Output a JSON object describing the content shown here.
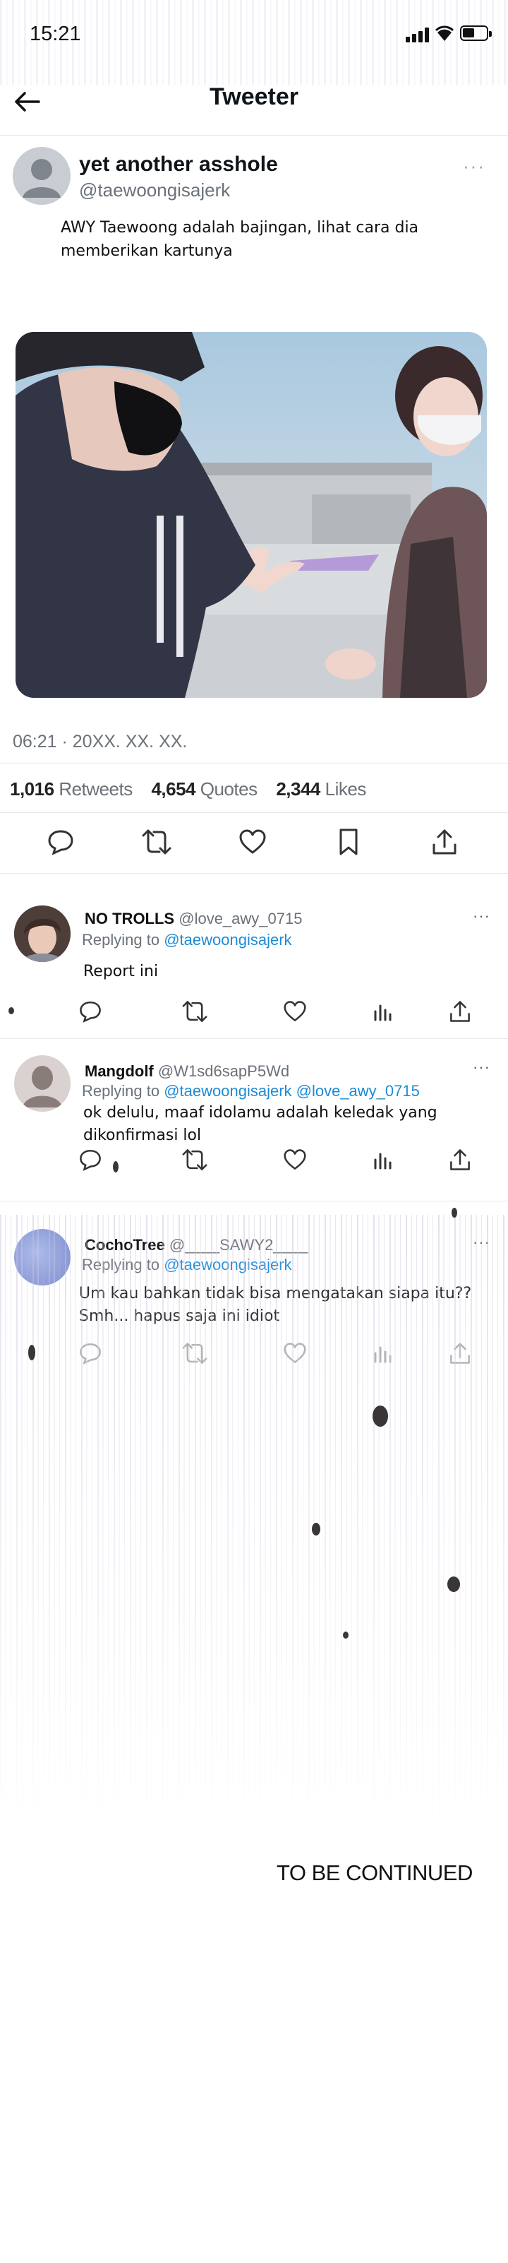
{
  "status_bar": {
    "time": "15:21"
  },
  "header": {
    "title": "Tweeter"
  },
  "tweet": {
    "display_name": "yet another asshole",
    "handle": "@taewoongisajerk",
    "more": "···",
    "text": "AWY Taewoong adalah bajingan, lihat cara dia memberikan kartunya",
    "meta": "06:21 · 20XX. XX. XX.",
    "stats": {
      "retweets_count": "1,016",
      "retweets_label": "Retweets",
      "quotes_count": "4,654",
      "quotes_label": "Quotes",
      "likes_count": "2,344",
      "likes_label": "Likes"
    }
  },
  "replies": [
    {
      "name": "NO TROLLS",
      "handle": "@love_awy_0715",
      "replying_prefix": "Replying to",
      "replying_to": "@taewoongisajerk",
      "text": "Report ini",
      "more": "···"
    },
    {
      "name": "Mangdolf",
      "handle": "@W1sd6sapP5Wd",
      "replying_prefix": "Replying to",
      "replying_to": "@taewoongisajerk @love_awy_0715",
      "text": "ok delulu, maaf idolamu adalah keledak yang dikonfirmasi lol",
      "more": "···"
    },
    {
      "name": "CochoTree",
      "handle": "@____SAWY2____",
      "replying_prefix": "Replying to",
      "replying_to": "@taewoongisajerk",
      "text": "Um kau bahkan tidak bisa mengatakan siapa itu?? Smh... hapus saja ini idiot",
      "more": "···"
    }
  ],
  "footer": {
    "to_be_continued": "TO BE CONTINUED"
  },
  "colors": {
    "link": "#1d8ad6",
    "muted": "#6b7178",
    "text": "#0f1419"
  },
  "icons": [
    "back-arrow-icon",
    "reply-icon",
    "retweet-icon",
    "like-icon",
    "bookmark-icon",
    "share-icon",
    "views-icon",
    "more-icon",
    "signal-icon",
    "wifi-icon",
    "battery-icon"
  ]
}
